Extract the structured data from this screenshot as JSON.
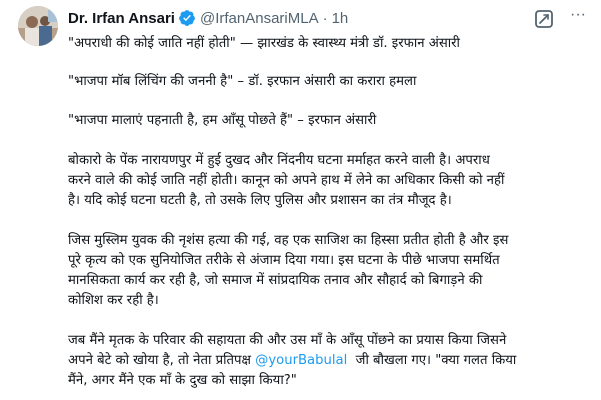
{
  "author": {
    "display_name": "Dr. Irfan Ansari",
    "handle": "@IrfanAnsariMLA",
    "separator": "·",
    "time": "1h",
    "more_glyph": "···"
  },
  "tweet": {
    "line_1": "\"अपराधी की कोई जाति नहीं होती\" — झारखंड के स्वास्थ्य मंत्री डॉ. इरफान अंसारी",
    "line_2": "\"भाजपा मॉब लिंचिंग की जननी है\" – डॉ. इरफान अंसारी का करारा हमला",
    "line_3": "\"भाजपा मालाएं पहनाती है, हम आँसू पोछते हैं\" – इरफान अंसारी",
    "para_4": [
      "बोकारो के पेंक नारायणपुर में हुई दुखद और निंदनीय घटना मर्माहत करने वाली है। अपराध",
      "करने वाले की कोई जाति नहीं होती। कानून को अपने हाथ में लेने का अधिकार किसी को नहीं",
      "है। यदि कोई घटना घटती है, तो उसके लिए पुलिस और प्रशासन का तंत्र मौजूद है।"
    ],
    "para_5": [
      "जिस मुस्लिम युवक की नृशंस हत्या की गई, वह एक साजिश का हिस्सा प्रतीत होती है और इस",
      "पूरे कृत्य को एक सुनियोजित तरीके से अंजाम दिया गया। इस घटना के पीछे भाजपा समर्थित",
      "मानसिकता कार्य कर रही है, जो समाज में सांप्रदायिक तनाव और सौहार्द को बिगाड़ने की",
      "कोशिश कर रही है।"
    ],
    "para_6_line_1": "जब मैंने मृतक के परिवार की सहायता की और उस माँ के आँसू पोंछने का प्रयास किया जिसने",
    "para_6_line_2_before": "अपने बेटे को खोया है, तो नेता प्रतिपक्ष ",
    "para_6_mention": "@yourBabulal",
    "para_6_line_2_after": "  जी बौखला गए। \"क्या गलत किया",
    "para_6_line_3": "मैंने, अगर मैंने एक माँ के दुख को साझा किया?\""
  },
  "colors": {
    "text": "#0f1419",
    "secondary": "#536471",
    "link": "#1d9bf0",
    "verified": "#1d9bf0"
  },
  "icons": [
    "avatar",
    "verified-badge-icon",
    "grok-icon",
    "more-options-icon"
  ]
}
